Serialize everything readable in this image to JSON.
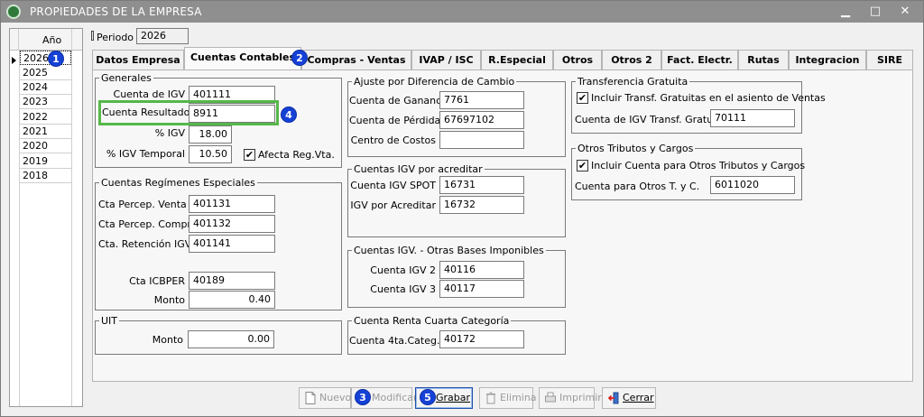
{
  "window": {
    "title": "PROPIEDADES DE LA EMPRESA",
    "min": "▁",
    "max": "□",
    "close": "✕"
  },
  "years": {
    "header": "Año",
    "rows": [
      "2026",
      "2025",
      "2024",
      "2023",
      "2022",
      "2021",
      "2020",
      "2019",
      "2018"
    ]
  },
  "callouts": {
    "c1": "1",
    "c2": "2",
    "c3": "3",
    "c4": "4",
    "c5": "5"
  },
  "periodo": {
    "label": "Periodo",
    "value": "2026"
  },
  "tabs": [
    "Datos Empresa",
    "Cuentas Contables",
    "Compras - Ventas",
    "IVAP / ISC",
    "R.Especial",
    "Otros",
    "Otros 2",
    "Fact. Electr.",
    "Rutas",
    "Integracion",
    "SIRE"
  ],
  "generales": {
    "legend": "Generales",
    "cuenta_igv_label": "Cuenta de IGV",
    "cuenta_igv": "401111",
    "cuenta_resultados_label": "Cuenta Resultados",
    "cuenta_resultados": "8911",
    "pct_igv_label": "% IGV",
    "pct_igv": "18.00",
    "pct_igv_temporal_label": "% IGV Temporal",
    "pct_igv_temporal": "10.50",
    "afecta_label": "Afecta Reg.Vta.",
    "afecta_check": "✔"
  },
  "regimenes": {
    "legend": "Cuentas Regímenes Especiales",
    "percep_venta_label": "Cta Percep. Venta",
    "percep_venta": "401131",
    "percep_compra_label": "Cta Percep. Compra",
    "percep_compra": "401132",
    "retencion_label": "Cta. Retención IGV",
    "retencion": "401141",
    "icbper_label": "Cta ICBPER",
    "icbper": "40189",
    "monto_label": "Monto",
    "monto": "0.40"
  },
  "uit": {
    "legend": "UIT",
    "monto_label": "Monto",
    "monto": "0.00"
  },
  "ajuste": {
    "legend": "Ajuste por Diferencia de Cambio",
    "ganancia_label": "Cuenta de Ganancia",
    "ganancia": "7761",
    "perdida_label": "Cuenta de Pérdida",
    "perdida": "67697102",
    "costos_label": "Centro de Costos",
    "costos": ""
  },
  "igv_acreditar": {
    "legend": "Cuentas IGV por acreditar",
    "spot_label": "Cuenta IGV SPOT",
    "spot": "16731",
    "igv_label": "IGV por Acreditar",
    "igv": "16732"
  },
  "otras_bases": {
    "legend": "Cuentas IGV. - Otras Bases Imponibles",
    "igv2_label": "Cuenta IGV 2",
    "igv2": "40116",
    "igv3_label": "Cuenta IGV 3",
    "igv3": "40117"
  },
  "renta_cuarta": {
    "legend": "Cuenta Renta Cuarta Categoría",
    "cuenta_label": "Cuenta 4ta.Categ.:",
    "cuenta": "40172"
  },
  "transferencia": {
    "legend": "Transferencia Gratuita",
    "check_label": "Incluir Transf. Gratuitas en el asiento de Ventas",
    "check": "✔",
    "cuenta_label": "Cuenta de IGV Transf. Gratuita",
    "cuenta": "70111"
  },
  "otros_tributos": {
    "legend": "Otros Tributos y Cargos",
    "check_label": "Incluir Cuenta para Otros Tributos y Cargos",
    "check": "✔",
    "cuenta_label": "Cuenta para Otros T. y C.",
    "cuenta": "6011020"
  },
  "toolbar": {
    "nuevo": "Nuevo",
    "modificar": "Modificar",
    "grabar": "Grabar",
    "elimina": "Elimina",
    "imprimir": "Imprimir",
    "cerrar": "Cerrar"
  },
  "colors": {
    "titlebar": "#8f8f8f",
    "callout": "#1541d6",
    "highlight": "#55b848"
  }
}
